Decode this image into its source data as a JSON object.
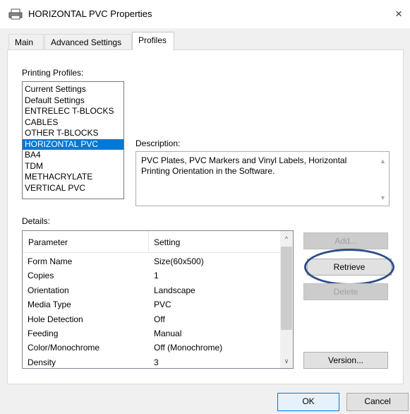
{
  "window": {
    "title": "HORIZONTAL PVC Properties",
    "close_glyph": "×",
    "icon": "printer-icon"
  },
  "tabs": [
    {
      "label": "Main",
      "active": false
    },
    {
      "label": "Advanced Settings",
      "active": false
    },
    {
      "label": "Profiles",
      "active": true
    }
  ],
  "profiles": {
    "label": "Printing Profiles:",
    "items": [
      "Current Settings",
      "Default Settings",
      "ENTRELEC T-BLOCKS",
      "CABLES",
      "OTHER T-BLOCKS",
      "HORIZONTAL PVC",
      "BA4",
      "TDM",
      "METHACRYLATE",
      "VERTICAL PVC"
    ],
    "selected": "HORIZONTAL PVC"
  },
  "description": {
    "label": "Description:",
    "text": "PVC Plates, PVC Markers and Vinyl Labels, Horizontal Printing Orientation in the Software."
  },
  "details": {
    "label": "Details:",
    "columns": [
      "Parameter",
      "Setting"
    ],
    "rows": [
      {
        "parameter": "Form Name",
        "setting": "Size(60x500)"
      },
      {
        "parameter": "Copies",
        "setting": "1"
      },
      {
        "parameter": "Orientation",
        "setting": "Landscape"
      },
      {
        "parameter": "Media Type",
        "setting": "PVC"
      },
      {
        "parameter": "Hole Detection",
        "setting": "Off"
      },
      {
        "parameter": "Feeding",
        "setting": "Manual"
      },
      {
        "parameter": "Color/Monochrome",
        "setting": "Off (Monochrome)"
      },
      {
        "parameter": "Density",
        "setting": "3"
      }
    ]
  },
  "buttons": {
    "add": "Add...",
    "retrieve": "Retrieve",
    "delete": "Delete",
    "version": "Version...",
    "ok": "OK",
    "cancel": "Cancel"
  },
  "colors": {
    "selection": "#0078d7",
    "annotation_oval": "#2e4f87"
  }
}
